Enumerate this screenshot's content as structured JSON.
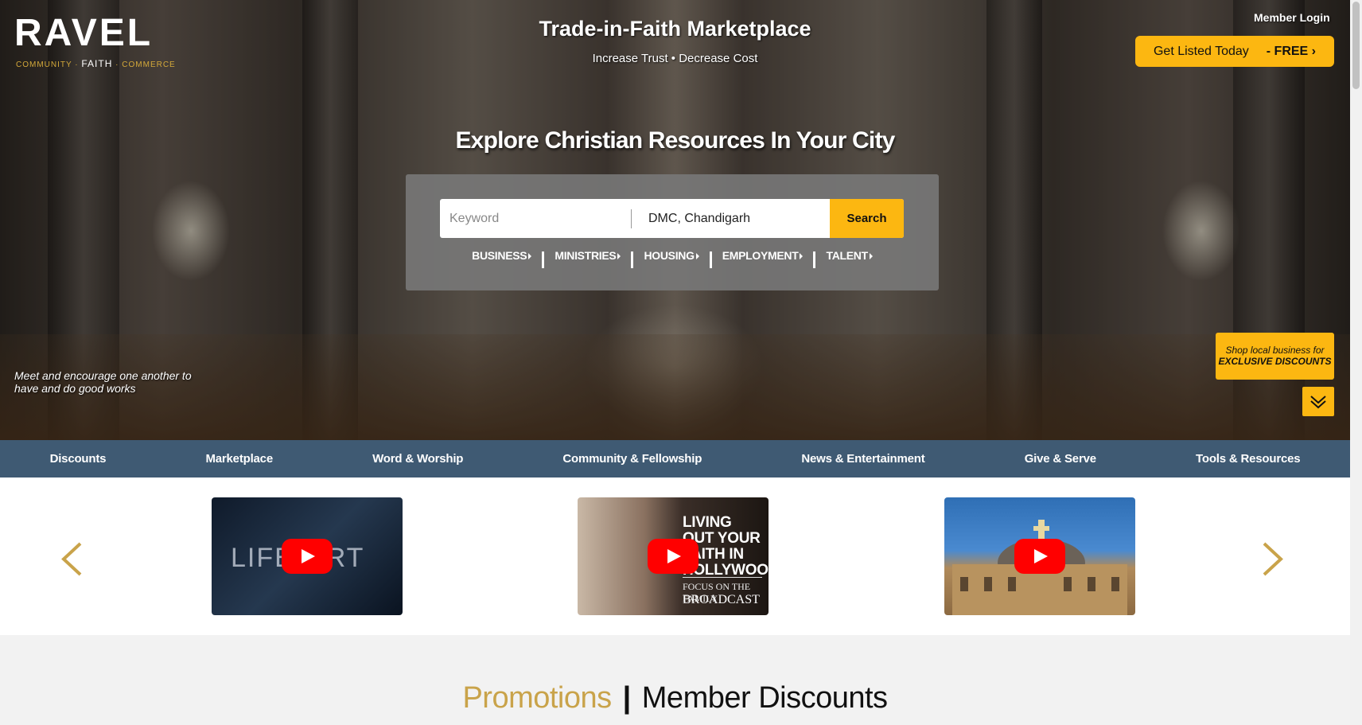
{
  "header": {
    "logo_text": "RAVEL",
    "logo_tag_left": "COMMUNITY",
    "logo_tag_mid": "FAITH",
    "logo_tag_right": "COMMERCE",
    "site_title": "Trade-in-Faith Marketplace",
    "site_subtitle": "Increase Trust • Decrease Cost",
    "member_login": "Member Login",
    "cta_label": "Get Listed Today",
    "cta_free": "- FREE"
  },
  "hero": {
    "heading": "Explore Christian Resources In Your City",
    "tagline": "Meet and encourage one another to have and do good works",
    "shop_badge_line1": "Shop local business for",
    "shop_badge_line2": "EXCLUSIVE DISCOUNTS"
  },
  "search": {
    "keyword_placeholder": "Keyword",
    "keyword_value": "",
    "location_value": "DMC, Chandigarh",
    "button_label": "Search",
    "categories": [
      "BUSINESS",
      "MINISTRIES",
      "HOUSING",
      "EMPLOYMENT",
      "TALENT"
    ]
  },
  "nav": {
    "items": [
      "Discounts",
      "Marketplace",
      "Word & Worship",
      "Community & Fellowship",
      "News & Entertainment",
      "Give & Serve",
      "Tools & Resources"
    ]
  },
  "videos": {
    "v1_text": "LIFE    ORT",
    "v2_title": "LIVING OUT YOUR FAITH IN HOLLYWOOD",
    "v2_brand": "FOCUS ON THE FAMILY",
    "v2_show": "BROADCAST"
  },
  "promos": {
    "left": "Promotions",
    "separator": "|",
    "right": "Member Discounts"
  },
  "colors": {
    "accent": "#fcb711",
    "nav_bg": "#3f5a73",
    "promo_gold": "#c9a34a"
  }
}
